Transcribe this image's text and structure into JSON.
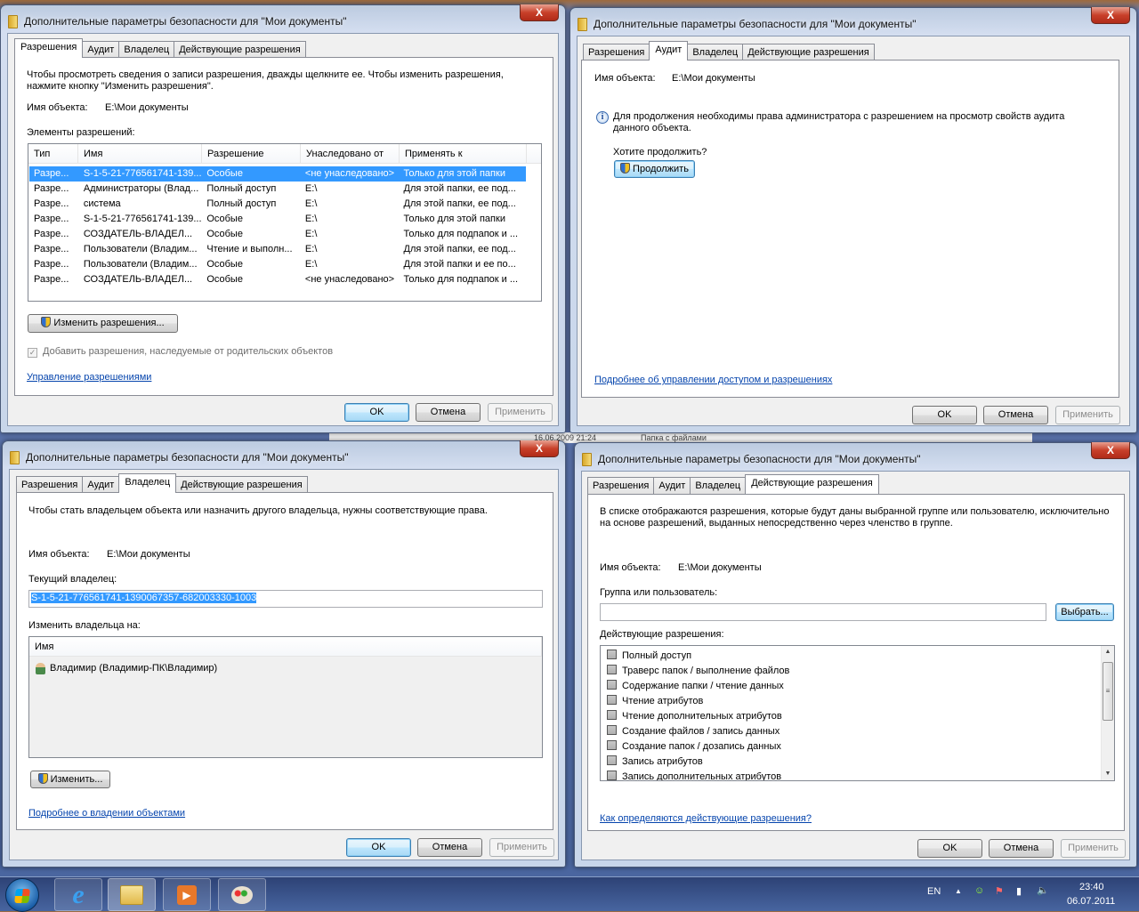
{
  "dialog_title": "Дополнительные параметры безопасности  для \"Мои документы\"",
  "close_label": "X",
  "tabs": [
    "Разрешения",
    "Аудит",
    "Владелец",
    "Действующие разрешения"
  ],
  "buttons": {
    "ok": "OK",
    "cancel": "Отмена",
    "apply": "Применить"
  },
  "object_name_label": "Имя объекта:",
  "object_name_value": "E:\\Мои документы",
  "permissions": {
    "description": "Чтобы просмотреть сведения о записи разрешения, дважды щелкните ее. Чтобы изменить разрешения, нажмите кнопку \"Изменить разрешения\".",
    "entries_label": "Элементы разрешений:",
    "columns": [
      "Тип",
      "Имя",
      "Разрешение",
      "Унаследовано от",
      "Применять к"
    ],
    "rows": [
      [
        "Разре...",
        "S-1-5-21-776561741-139...",
        "Особые",
        "<не унаследовано>",
        "Только для этой папки"
      ],
      [
        "Разре...",
        "Администраторы (Влад...",
        "Полный доступ",
        "E:\\",
        "Для этой папки, ее под..."
      ],
      [
        "Разре...",
        "система",
        "Полный доступ",
        "E:\\",
        "Для этой папки, ее под..."
      ],
      [
        "Разре...",
        "S-1-5-21-776561741-139...",
        "Особые",
        "E:\\",
        "Только для этой папки"
      ],
      [
        "Разре...",
        "СОЗДАТЕЛЬ-ВЛАДЕЛ...",
        "Особые",
        "E:\\",
        "Только для подпапок и ..."
      ],
      [
        "Разре...",
        "Пользователи (Владим...",
        "Чтение и выполн...",
        "E:\\",
        "Для этой папки, ее под..."
      ],
      [
        "Разре...",
        "Пользователи (Владим...",
        "Особые",
        "E:\\",
        "Для этой папки и ее по..."
      ],
      [
        "Разре...",
        "СОЗДАТЕЛЬ-ВЛАДЕЛ...",
        "Особые",
        "<не унаследовано>",
        "Только для подпапок и ..."
      ]
    ],
    "selected_row": 0,
    "change_button": "Изменить разрешения...",
    "inherit_checkbox": "Добавить разрешения, наследуемые от родительских объектов",
    "inherit_checked": true,
    "manage_link": "Управление разрешениями"
  },
  "audit": {
    "info": "Для продолжения необходимы права администратора с разрешением на просмотр свойств аудита данного объекта.",
    "question": "Хотите продолжить?",
    "continue_button": "Продолжить",
    "link": "Подробнее об управлении доступом и разрешениях"
  },
  "owner": {
    "description": "Чтобы стать владельцем объекта или назначить другого владельца, нужны соответствующие права.",
    "current_owner_label": "Текущий владелец:",
    "current_owner_value": "S-1-5-21-776561741-1390067357-682003330-1003",
    "change_to_label": "Изменить владельца на:",
    "list_header": "Имя",
    "list_items": [
      "Владимир (Владимир-ПК\\Владимир)"
    ],
    "change_button": "Изменить...",
    "link": "Подробнее о владении объектами"
  },
  "effective": {
    "description": "В списке отображаются разрешения, которые будут даны выбранной группе или пользователю, исключительно на основе разрешений, выданных непосредственно через членство в группе.",
    "group_label": "Группа или пользователь:",
    "group_value": "",
    "select_button": "Выбрать...",
    "effective_label": "Действующие разрешения:",
    "items": [
      "Полный доступ",
      "Траверс папок / выполнение файлов",
      "Содержание папки / чтение данных",
      "Чтение атрибутов",
      "Чтение дополнительных атрибутов",
      "Создание файлов / запись данных",
      "Создание папок / дозапись данных",
      "Запись атрибутов",
      "Запись дополнительных атрибутов"
    ],
    "link": "Как определяются действующие разрешения?"
  },
  "background_window": {
    "date": "16.06.2009 21:24",
    "type": "Папка с файлами"
  },
  "taskbar": {
    "apps": [
      "start-button",
      "internet-explorer",
      "windows-explorer",
      "media-player",
      "paint"
    ],
    "language": "EN",
    "time": "23:40",
    "date": "06.07.2011"
  }
}
